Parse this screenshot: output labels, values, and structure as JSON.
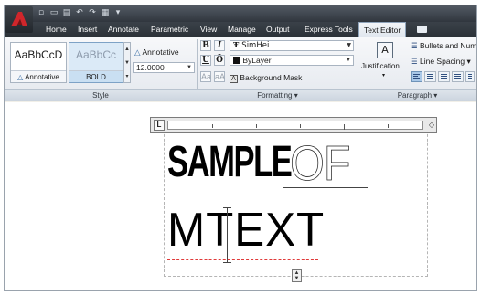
{
  "quick_access": [
    "▫",
    "▭",
    "▤",
    "↶",
    "↷",
    "▦",
    "▾"
  ],
  "tabs": [
    {
      "label": "Home"
    },
    {
      "label": "Insert"
    },
    {
      "label": "Annotate"
    },
    {
      "label": "Parametric"
    },
    {
      "label": "View"
    },
    {
      "label": "Manage"
    },
    {
      "label": "Output"
    },
    {
      "label": "Express Tools"
    },
    {
      "label": "Text Editor",
      "active": true
    }
  ],
  "style_panel": {
    "title": "Style",
    "styles": [
      {
        "sample": "AaBbCcD",
        "caption": "Annotative",
        "caption_icon": "annotative-icon"
      },
      {
        "sample": "AaBbCc",
        "caption": "BOLD",
        "selected": true
      }
    ],
    "annotative_label": "Annotative",
    "text_height": "12.0000"
  },
  "formatting_panel": {
    "title": "Formatting ▾",
    "bold": "B",
    "italic": "I",
    "underline": "U",
    "overline": "Ō",
    "font": "SimHei",
    "color": "ByLayer",
    "uppercase": "Aa",
    "lowercase": "aA",
    "background_mask": "Background Mask"
  },
  "paragraph_panel": {
    "title": "Paragraph ▾",
    "justification": "Justification",
    "bullets": "Bullets and Num",
    "line_spacing": "Line Spacing ▾"
  },
  "canvas": {
    "ruler_corner": "L",
    "line1_word1": "SAMPLE",
    "line1_word2": "OF",
    "line2": "MTEXT"
  },
  "colors": {
    "titlebar": "#30363e",
    "active_tab": "#dfe6ee",
    "selected_style": "#dbeaf7"
  }
}
